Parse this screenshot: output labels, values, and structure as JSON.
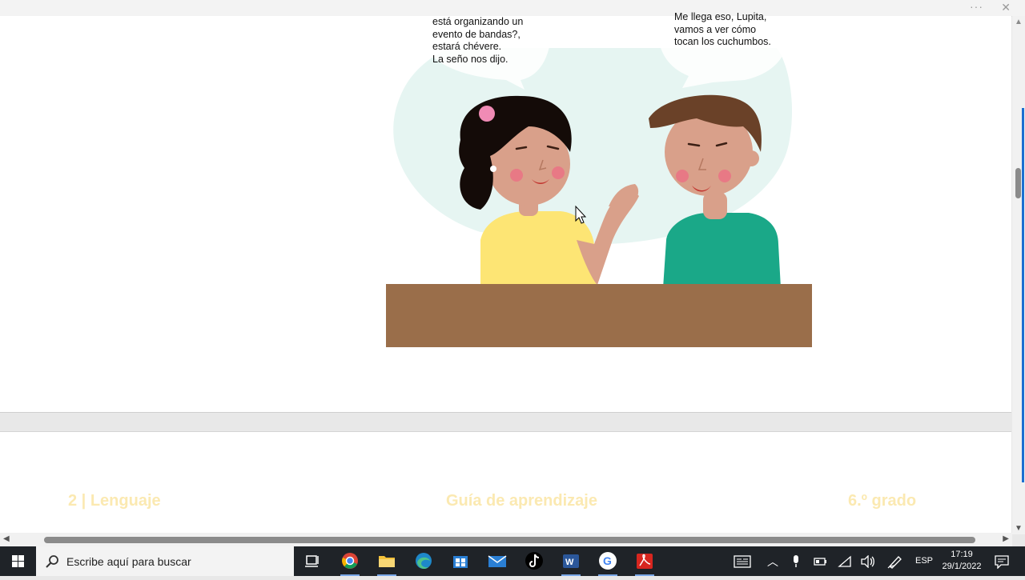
{
  "window": {
    "more_icon": "more-dots-icon",
    "close_icon": "close-icon"
  },
  "comic": {
    "girl_bubble_lines": [
      "está organizando un",
      "evento de bandas?,",
      "estará chévere.",
      "La seño nos dijo."
    ],
    "boy_bubble_lines": [
      "Me llega eso, Lupita,",
      "vamos a ver cómo",
      "tocan los cuchumbos."
    ],
    "colors": {
      "bubble": "#e6f5f2",
      "desk": "#9a6e4a",
      "girl_shirt": "#fde574",
      "boy_shirt": "#1aa888",
      "skin": "#d9a08a",
      "hair_girl": "#140b08",
      "hair_boy": "#6a4128"
    }
  },
  "footer": {
    "left": "2 | Lenguaje",
    "center": "Guía de aprendizaje",
    "right": "6.º grado",
    "color": "#fbe9b1"
  },
  "taskbar": {
    "search_placeholder": "Escribe aquí para buscar",
    "apps": [
      "task-view-icon",
      "chrome-icon",
      "file-explorer-icon",
      "edge-icon",
      "store-icon",
      "mail-icon",
      "tiktok-icon",
      "word-icon",
      "google-icon",
      "acrobat-icon"
    ],
    "tray": {
      "language": "ESP",
      "time": "17:19",
      "date": "29/1/2022"
    }
  }
}
